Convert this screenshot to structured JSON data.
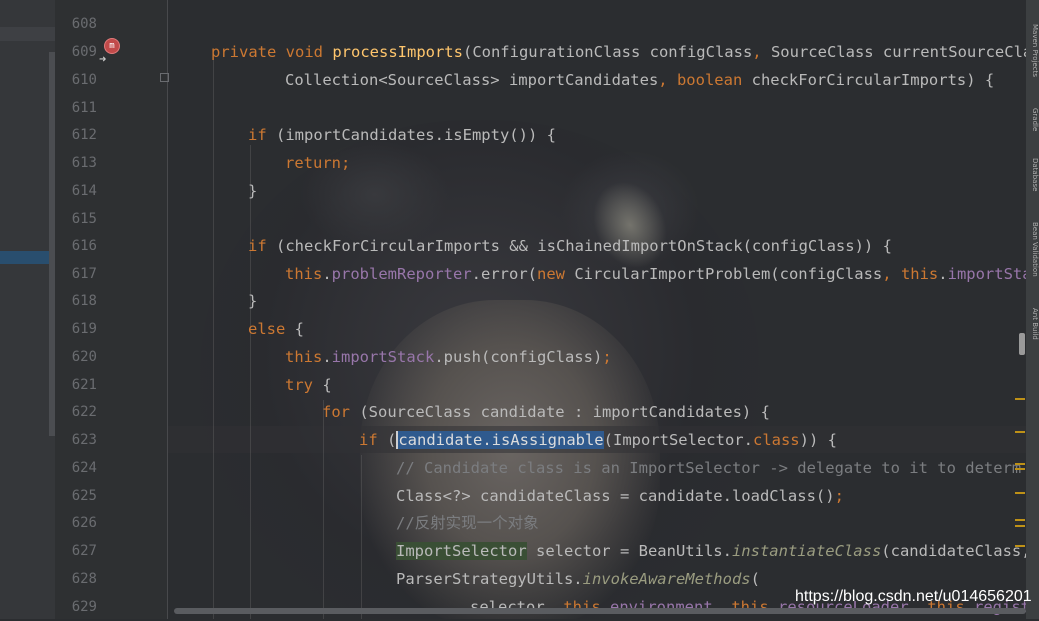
{
  "gutter": {
    "line_numbers": [
      "608",
      "609",
      "610",
      "611",
      "612",
      "613",
      "614",
      "615",
      "616",
      "617",
      "618",
      "619",
      "620",
      "621",
      "622",
      "623",
      "624",
      "625",
      "626",
      "627",
      "628",
      "629"
    ],
    "method_badge": "m",
    "impl_icon": "override-arrow-icon"
  },
  "code": {
    "l609": {
      "kw1": "private void ",
      "fn": "processImports",
      "p1": "(ConfigurationClass configClass",
      "c1": ", ",
      "p2": "SourceClass currentSourceCla"
    },
    "l610": {
      "t1": "Collection<SourceClass> importCandidates",
      "c1": ", ",
      "kw": "boolean ",
      "t2": "checkForCircularImports) {"
    },
    "l612": {
      "kw": "if ",
      "t": "(importCandidates.isEmpty()) {"
    },
    "l613": {
      "kw": "return",
      "t": ";"
    },
    "l614": {
      "t": "}"
    },
    "l616": {
      "kw": "if ",
      "t": "(checkForCircularImports && isChainedImportOnStack(configClass)) {"
    },
    "l617": {
      "kw1": "this",
      "dot1": ".",
      "f1": "problemReporter",
      "t1": ".error(",
      "kw2": "new ",
      "t2": "CircularImportProblem(configClass",
      "c1": ", ",
      "kw3": "this",
      "dot2": ".",
      "f2": "importSta"
    },
    "l618": {
      "t": "}"
    },
    "l619": {
      "kw": "else ",
      "t": "{"
    },
    "l620": {
      "kw": "this",
      "dot": ".",
      "f": "importStack",
      "t": ".push(configClass)",
      "semi": ";"
    },
    "l621": {
      "kw": "try ",
      "t": "{"
    },
    "l622": {
      "kw": "for ",
      "t": "(SourceClass candidate : importCandidates) {"
    },
    "l623": {
      "kw": "if ",
      "t1": "(",
      "sel": "candidate.isAssignable",
      "t2": "(ImportSelector",
      "t3": ".",
      "kw2": "class",
      "t4": ")) {"
    },
    "l624": {
      "cm": "// Candidate class is an ImportSelector -> delegate to it to determ"
    },
    "l625": {
      "t": "Class<?> candidateClass = candidate.loadClass()",
      "semi": ";"
    },
    "l626": {
      "cm": "//反射实现一个对象"
    },
    "l627": {
      "usage": "ImportSelector",
      "t1": " selector = BeanUtils.",
      "st": "instantiateClass",
      "t2": "(candidateClass,"
    },
    "l628": {
      "t1": "ParserStrategyUtils.",
      "st": "invokeAwareMethods",
      "t2": "("
    },
    "l629": {
      "t1": "selector",
      "c1": ", ",
      "kw1": "this",
      "d1": ".",
      "f1": "environment",
      "c2": ", ",
      "kw2": "this",
      "d2": ".",
      "f2": "resourceLoader",
      "c3": ", ",
      "kw3": "this",
      "d3": ".",
      "f3": "regist"
    }
  },
  "right_tabs": [
    "Maven Projects",
    "Gradle",
    "Database",
    "Bean Validation",
    "Ant Build"
  ],
  "watermark": "https://blog.csdn.net/u014656201"
}
